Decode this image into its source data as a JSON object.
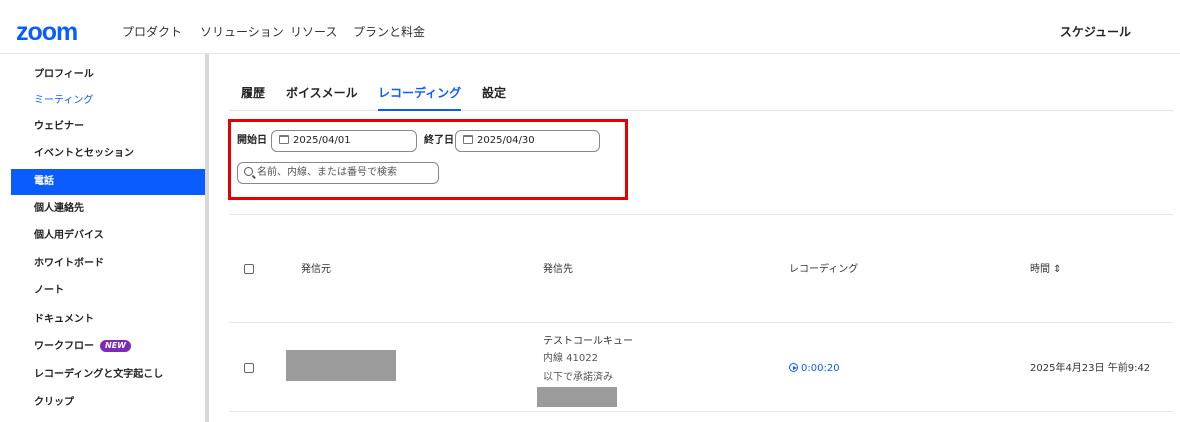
{
  "topnav": {
    "logo": "zoom",
    "links": [
      "プロダクト",
      "ソリューション",
      "リソース",
      "プランと料金"
    ],
    "right": "スケジュール"
  },
  "sidebar": {
    "items": [
      {
        "label": "プロフィール"
      },
      {
        "label": "ミーティング"
      },
      {
        "label": "ウェビナー"
      },
      {
        "label": "イベントとセッション"
      },
      {
        "label": "電話"
      },
      {
        "label": "個人連絡先"
      },
      {
        "label": "個人用デバイス"
      },
      {
        "label": "ホワイトボード"
      },
      {
        "label": "ノート"
      },
      {
        "label": "ドキュメント"
      },
      {
        "label": "ワークフロー",
        "badge": "NEW"
      },
      {
        "label": "レコーディングと文字起こし"
      },
      {
        "label": "クリップ"
      }
    ],
    "active_label": "電話",
    "link_color": "#0b5cff"
  },
  "tabs": [
    {
      "label": "履歴"
    },
    {
      "label": "ボイスメール"
    },
    {
      "label": "レコーディング",
      "active": true
    },
    {
      "label": "設定"
    }
  ],
  "filters": {
    "start_label": "開始日",
    "start_value": "2025/04/01",
    "end_label": "終了日",
    "end_value": "2025/04/30",
    "search_placeholder": "名前、内線、または番号で検索",
    "highlight_color": "#e60000"
  },
  "table": {
    "headers": {
      "from": "発信元",
      "to": "発信先",
      "recording": "レコーディング",
      "time": "時間 ⇕"
    },
    "rows": [
      {
        "to_name": "テストコールキュー",
        "to_ext": "内線 41022",
        "to_note": "以下で承諾済み",
        "recording": "0:00:20",
        "time": "2025年4月23日 午前9:42"
      }
    ]
  },
  "colors": {
    "accent": "#0b5cff",
    "active_bg": "#0b5cff",
    "badge": "#7b2bb8"
  }
}
